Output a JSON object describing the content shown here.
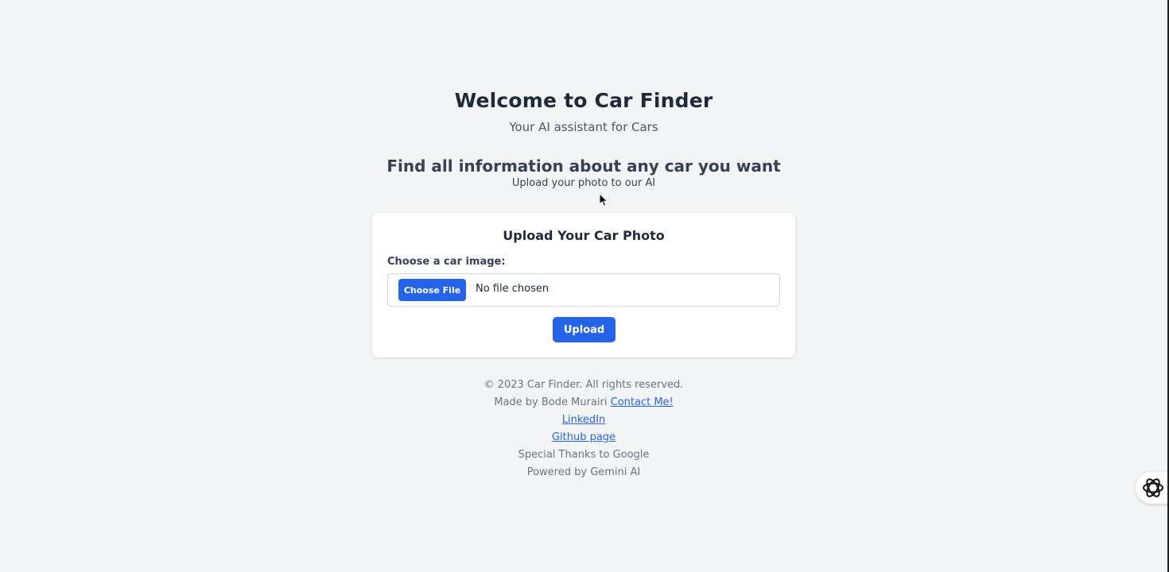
{
  "header": {
    "title": "Welcome to Car Finder",
    "subtitle": "Your AI assistant for Cars"
  },
  "intro": {
    "tagline": "Find all information about any car you want",
    "sub": "Upload your photo to our AI"
  },
  "upload_card": {
    "title": "Upload Your Car Photo",
    "field_label": "Choose a car image:",
    "choose_button": "Choose File",
    "file_status": "No file chosen",
    "upload_button": "Upload"
  },
  "footer": {
    "copyright": "© 2023 Car Finder. All rights reserved.",
    "made_by": "Made by Bode Murairi",
    "contact_link": "Contact Me!",
    "linkedin_link": "LinkedIn",
    "github_link": "Github page",
    "thanks": "Special Thanks to Google",
    "powered_by": "Powered by Gemini AI"
  },
  "floating": {
    "icon": "openai-logo-icon"
  },
  "colors": {
    "background": "#f3f4f6",
    "accent": "#2563eb",
    "card": "#ffffff"
  }
}
